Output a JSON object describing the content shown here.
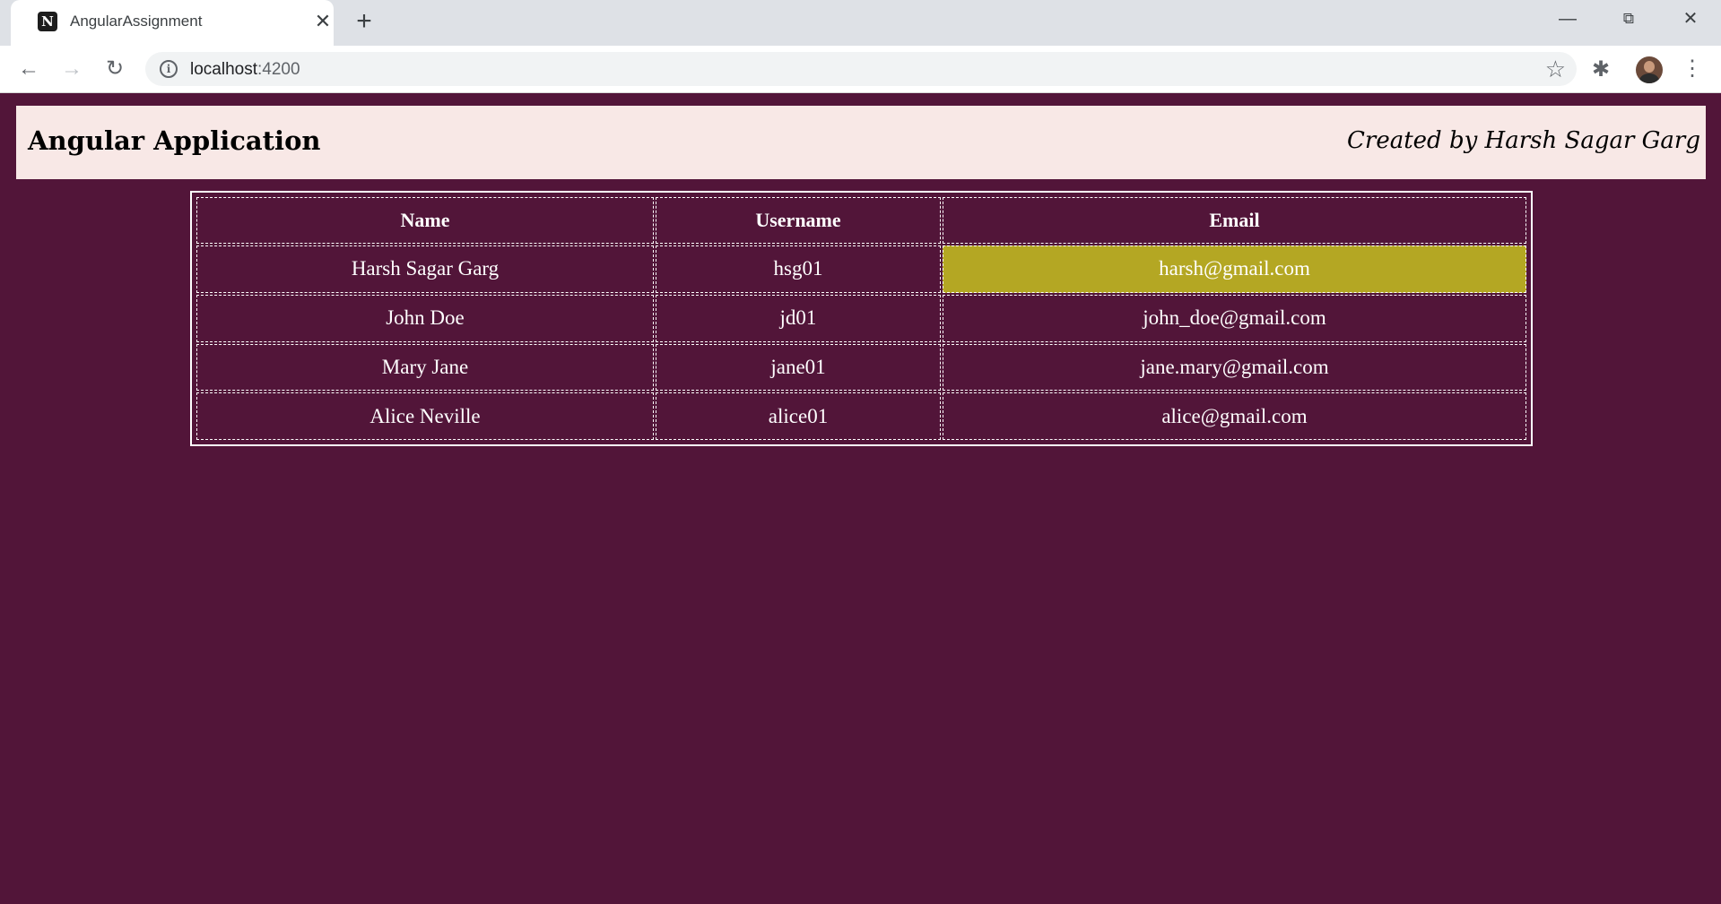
{
  "browser": {
    "tab_title": "AngularAssignment",
    "favicon_letter": "N",
    "url_host": "localhost",
    "url_port": ":4200"
  },
  "header": {
    "title": "Angular Application",
    "credit": "Created by Harsh Sagar Garg"
  },
  "table": {
    "columns": [
      "Name",
      "Username",
      "Email"
    ],
    "rows": [
      {
        "name": "Harsh Sagar Garg",
        "username": "hsg01",
        "email": "harsh@gmail.com",
        "highlighted": true
      },
      {
        "name": "John Doe",
        "username": "jd01",
        "email": "john_doe@gmail.com",
        "highlighted": false
      },
      {
        "name": "Mary Jane",
        "username": "jane01",
        "email": "jane.mary@gmail.com",
        "highlighted": false
      },
      {
        "name": "Alice Neville",
        "username": "alice01",
        "email": "alice@gmail.com",
        "highlighted": false
      }
    ]
  },
  "colors": {
    "page_background": "#521539",
    "header_background": "#f8e8e6",
    "highlight": "#b4a723"
  }
}
